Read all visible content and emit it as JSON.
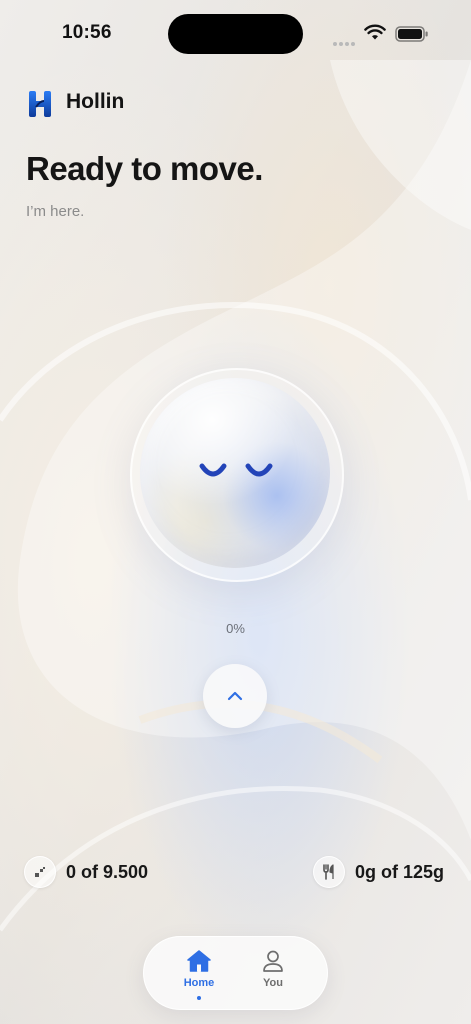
{
  "status_bar": {
    "time": "10:56"
  },
  "brand": {
    "name": "Hollin"
  },
  "hero": {
    "title": "Ready to move.",
    "subtitle": "I’m here."
  },
  "orb": {
    "progress_label": "0%",
    "progress": 0
  },
  "stats": {
    "steps": {
      "value": "0 of 9.500",
      "icon": "steps-icon"
    },
    "food": {
      "value": "0g of 125g",
      "icon": "fork-knife-icon"
    }
  },
  "tabs": [
    {
      "label": "Home",
      "icon": "home-icon",
      "active": true
    },
    {
      "label": "You",
      "icon": "person-icon",
      "active": false
    }
  ],
  "colors": {
    "accent": "#2f6fe4",
    "eyes": "#2344b8",
    "text": "#151515"
  }
}
